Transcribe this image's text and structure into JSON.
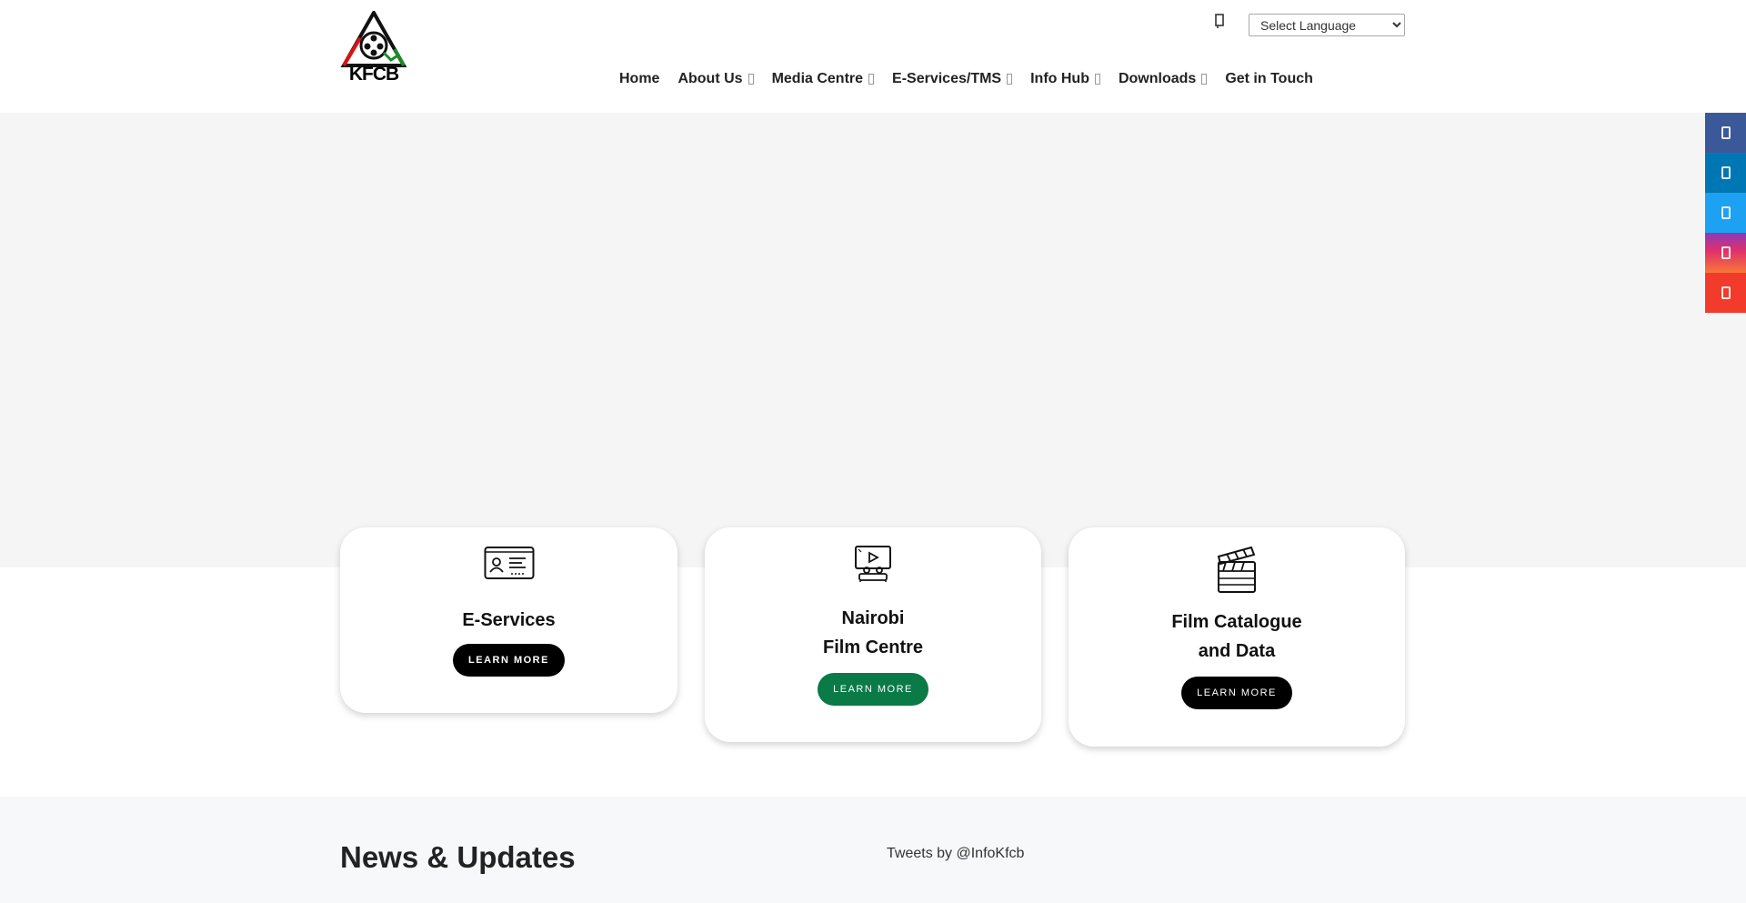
{
  "header": {
    "logo_text": "KFCB",
    "language_select": {
      "selected": "Select Language"
    },
    "nav": [
      {
        "label": "Home",
        "has_dropdown": false
      },
      {
        "label": "About Us",
        "has_dropdown": true
      },
      {
        "label": "Media Centre",
        "has_dropdown": true
      },
      {
        "label": "E-Services/TMS",
        "has_dropdown": true
      },
      {
        "label": "Info Hub",
        "has_dropdown": true
      },
      {
        "label": "Downloads",
        "has_dropdown": true
      },
      {
        "label": "Get in Touch",
        "has_dropdown": false
      }
    ]
  },
  "social": [
    {
      "icon": "facebook-icon",
      "color": "#3b5998"
    },
    {
      "icon": "linkedin-icon",
      "color": "#0077b5"
    },
    {
      "icon": "twitter-icon",
      "color": "#1da1f2"
    },
    {
      "icon": "instagram-icon",
      "color": "#e1306c"
    },
    {
      "icon": "youtube-icon",
      "color": "#f23b2a"
    }
  ],
  "cards": [
    {
      "title_lines": [
        "E-Services"
      ],
      "button": "LEARN MORE",
      "button_color": "#000000",
      "icon": "id-card-icon"
    },
    {
      "title_lines": [
        "Nairobi",
        "Film Centre"
      ],
      "button": "LEARN MORE",
      "button_color": "#0a7a47",
      "icon": "cinema-screen-icon"
    },
    {
      "title_lines": [
        "Film Catalogue",
        "and Data"
      ],
      "button": "LEARN MORE",
      "button_color": "#000000",
      "icon": "clapperboard-icon"
    }
  ],
  "news": {
    "title": "News & Updates",
    "tweets_link": "Tweets by @InfoKfcb"
  },
  "colors": {
    "hero_bg": "#f5f5f5",
    "news_bg": "#f7f8f9",
    "accent_green": "#0a7a47"
  }
}
